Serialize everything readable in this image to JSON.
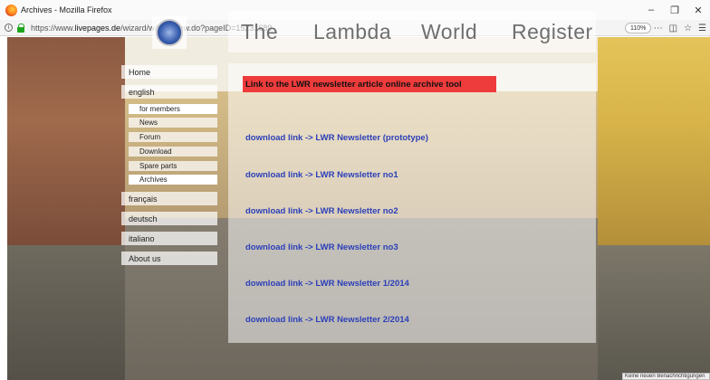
{
  "browser": {
    "window_title": "Archives - Mozilla Firefox",
    "url_prefix": "https://www.",
    "url_host": "livepages.de",
    "url_path": "/wizard/w4/preview.do?pageID=15231689",
    "zoom": "110%",
    "status_text": "Keine neuen Benachrichtigungen"
  },
  "header": {
    "nav": [
      "The",
      "Lambda",
      "World",
      "Register"
    ]
  },
  "sidebar": {
    "items": [
      {
        "label": "Home",
        "level": "main"
      },
      {
        "label": "english",
        "level": "main"
      },
      {
        "label": "for members",
        "level": "sub",
        "active": true
      },
      {
        "label": "News",
        "level": "sub"
      },
      {
        "label": "Forum",
        "level": "sub"
      },
      {
        "label": "Download",
        "level": "sub"
      },
      {
        "label": "Spare parts",
        "level": "sub"
      },
      {
        "label": "Archives",
        "level": "sub",
        "active": true
      },
      {
        "label": "français",
        "level": "main"
      },
      {
        "label": "deutsch",
        "level": "main"
      },
      {
        "label": "italiano",
        "level": "main"
      },
      {
        "label": "About us",
        "level": "main"
      }
    ]
  },
  "main": {
    "archive_link": "Link to the LWR newsletter article online archive tool",
    "links": [
      "download link -> LWR Newsletter (prototype)",
      "download link -> LWR Newsletter no1",
      "download link -> LWR Newsletter no2",
      "download link -> LWR Newsletter no3",
      "download link -> LWR Newsletter 1/2014",
      "download link -> LWR Newsletter 2/2014"
    ]
  },
  "colors": {
    "link": "#2b3fb8",
    "highlight": "#ee3b3b",
    "nav_text": "#6f6f6f"
  }
}
